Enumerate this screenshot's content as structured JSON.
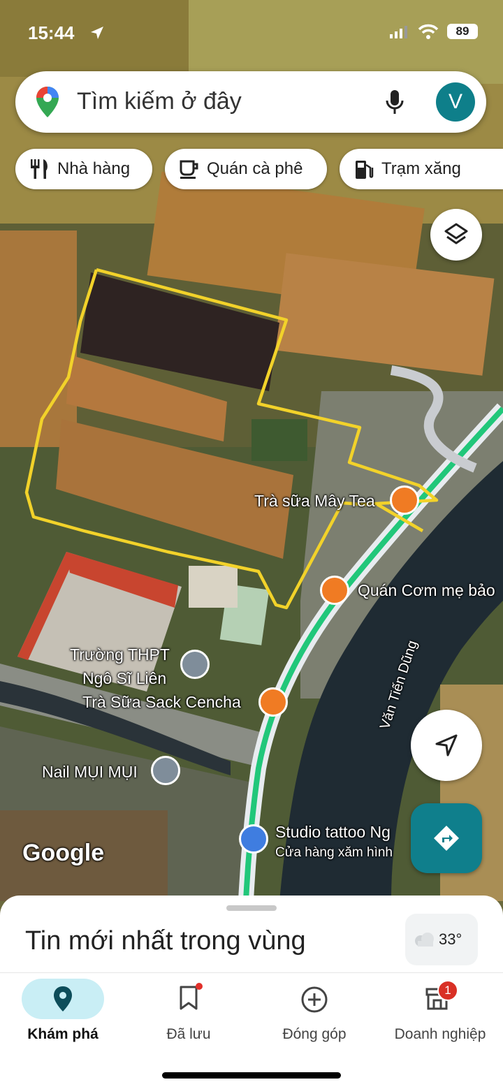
{
  "status_bar": {
    "time": "15:44",
    "battery": "89"
  },
  "search": {
    "placeholder": "Tìm kiếm ở đây",
    "avatar_letter": "V"
  },
  "chips": [
    {
      "label": "Nhà hàng",
      "icon": "restaurant-icon"
    },
    {
      "label": "Quán cà phê",
      "icon": "coffee-icon"
    },
    {
      "label": "Trạm xăng",
      "icon": "gas-station-icon"
    }
  ],
  "map": {
    "watermark": "Google",
    "road_name": "Văn Tiến Dũng",
    "places": [
      {
        "name": "Trà sữa Mây Tea",
        "icon": "cafe-icon"
      },
      {
        "name": "Quán Cơm mẹ bảo",
        "icon": "restaurant-icon"
      },
      {
        "name": "Trường THPT",
        "name_line2": "Ngô Sĩ Liên",
        "icon": "school-icon"
      },
      {
        "name": "Trà Sữa Sack Cencha",
        "icon": "cafe-icon"
      },
      {
        "name": "Nail MỤI MỤI",
        "icon": "place-icon"
      },
      {
        "name": "Studio tattoo Ng",
        "subtitle": "Cửa hàng xăm hình",
        "icon": "shop-icon"
      }
    ],
    "highlight_color": "#f2d22a",
    "route_color": "#21c77a"
  },
  "sheet": {
    "title": "Tin mới nhất trong vùng",
    "temperature": "33°"
  },
  "nav": [
    {
      "label": "Khám phá",
      "icon": "explore-pin-icon",
      "active": true
    },
    {
      "label": "Đã lưu",
      "icon": "bookmark-icon"
    },
    {
      "label": "Đóng góp",
      "icon": "add-circle-icon"
    },
    {
      "label": "Doanh nghiệp",
      "icon": "storefront-icon",
      "badge": "1"
    }
  ]
}
